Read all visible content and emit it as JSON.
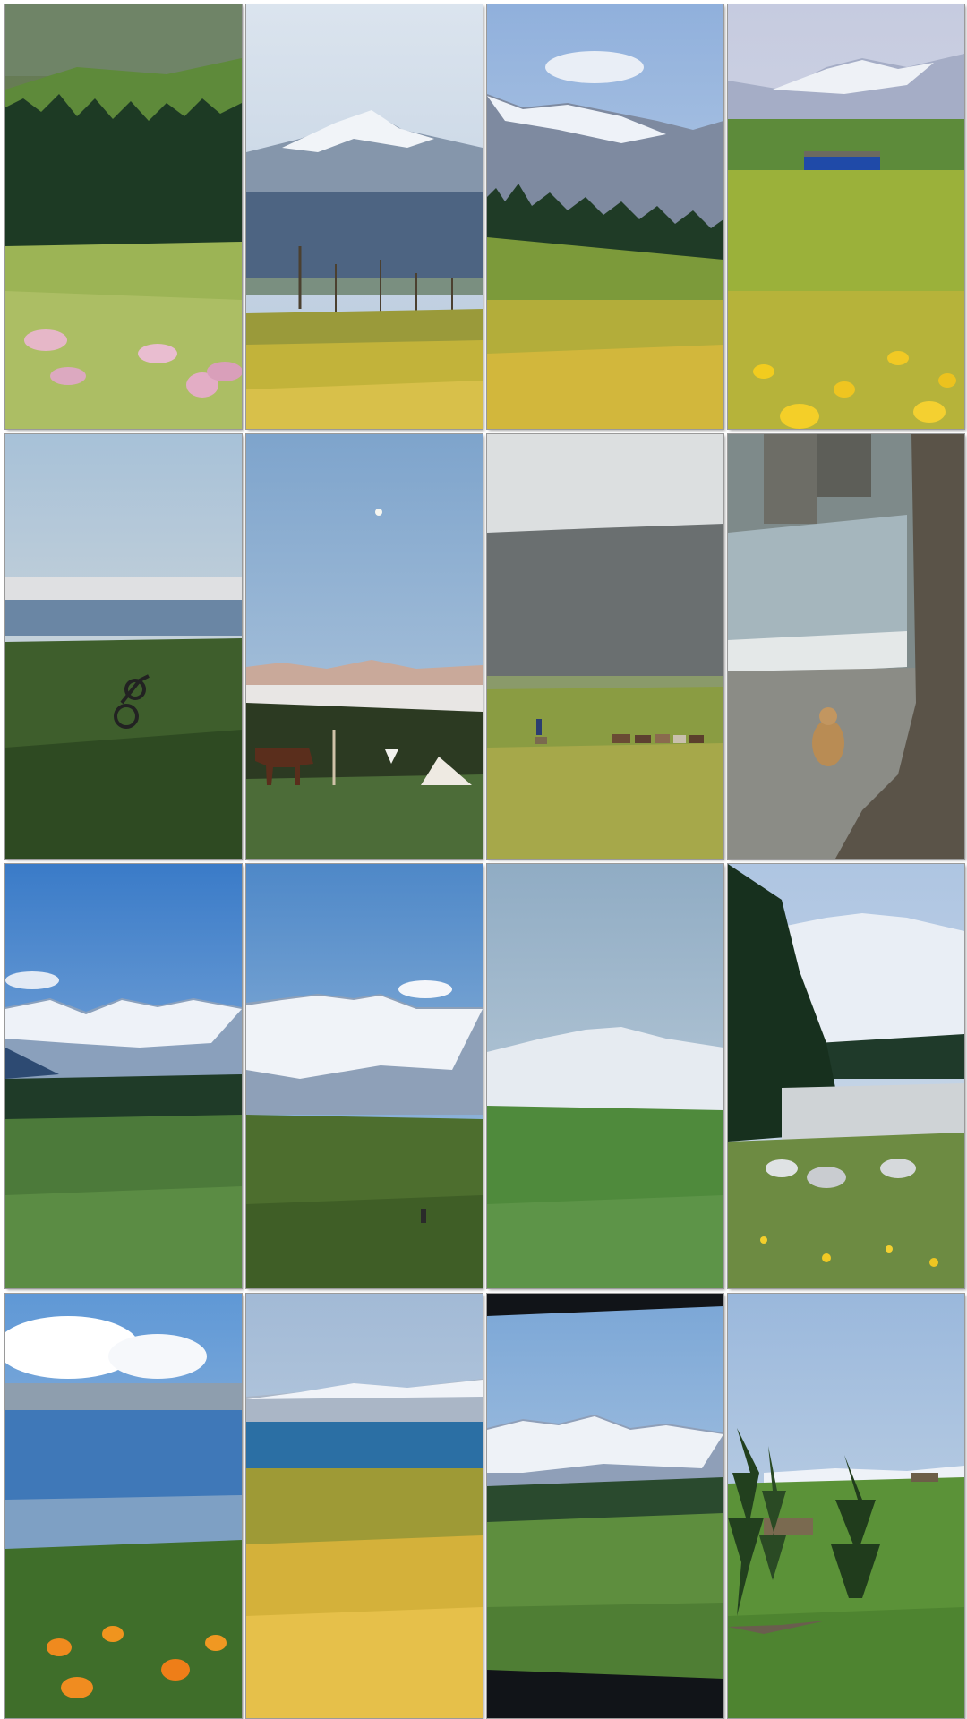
{
  "collage": {
    "columns": 4,
    "rows": 4,
    "photos": [
      {
        "subject": "hillside-pine-forest-with-pink-wildflowers",
        "colors": {
          "sky": "#7d8f76",
          "ground": "#8aa84a"
        }
      },
      {
        "subject": "snow-mountain-fence-yellow-flower-meadow",
        "colors": {
          "sky": "#c9d7e6",
          "ground": "#b9b23a"
        }
      },
      {
        "subject": "snow-peaks-spruce-row-yellow-flowers",
        "colors": {
          "sky": "#a9c3e4",
          "ground": "#c7b53a"
        }
      },
      {
        "subject": "blue-cabin-on-grassland-yellow-flowers",
        "colors": {
          "sky": "#c4cde0",
          "ground": "#b3b83e"
        }
      },
      {
        "subject": "motorbike-on-dark-grass-under-pale-sky",
        "colors": {
          "sky": "#bcd2e2",
          "ground": "#3c5a2c"
        }
      },
      {
        "subject": "horse-tent-moon-evening-valley",
        "colors": {
          "sky": "#8fb0d2",
          "ground": "#48683a"
        }
      },
      {
        "subject": "rider-with-herd-on-hazy-grassland",
        "colors": {
          "sky": "#d8dcde",
          "ground": "#8c9a40"
        }
      },
      {
        "subject": "squirrel-beside-tree-trunk-by-stream",
        "colors": {
          "sky": "#9aa4a6",
          "ground": "#6f6a62"
        }
      },
      {
        "subject": "snow-range-over-green-valley",
        "colors": {
          "sky": "#4f8ccf",
          "ground": "#4c7a3a"
        }
      },
      {
        "subject": "person-walking-in-valley-below-snow-peaks",
        "colors": {
          "sky": "#5d94cc",
          "ground": "#4a6e2e"
        }
      },
      {
        "subject": "hazy-snow-mountain-over-green-slope",
        "colors": {
          "sky": "#9cb5c8",
          "ground": "#4f8a3c"
        }
      },
      {
        "subject": "spruce-fence-rocks-and-yellow-flowers",
        "colors": {
          "sky": "#b8cce2",
          "ground": "#6c8a42"
        }
      },
      {
        "subject": "blue-lake-under-white-clouds-orange-poppies",
        "colors": {
          "sky": "#6d9ed6",
          "ground": "#3f6e2a"
        }
      },
      {
        "subject": "turquoise-lake-behind-golden-flower-field",
        "colors": {
          "sky": "#aec3d9",
          "ground": "#cfa633"
        }
      },
      {
        "subject": "window-framed-snow-peaks-green-hills",
        "colors": {
          "sky": "#8fb2d8",
          "ground": "#5e8e3e"
        }
      },
      {
        "subject": "spruce-trees-and-cabin-on-meadow",
        "colors": {
          "sky": "#a7c1de",
          "ground": "#5b9238"
        }
      }
    ]
  }
}
